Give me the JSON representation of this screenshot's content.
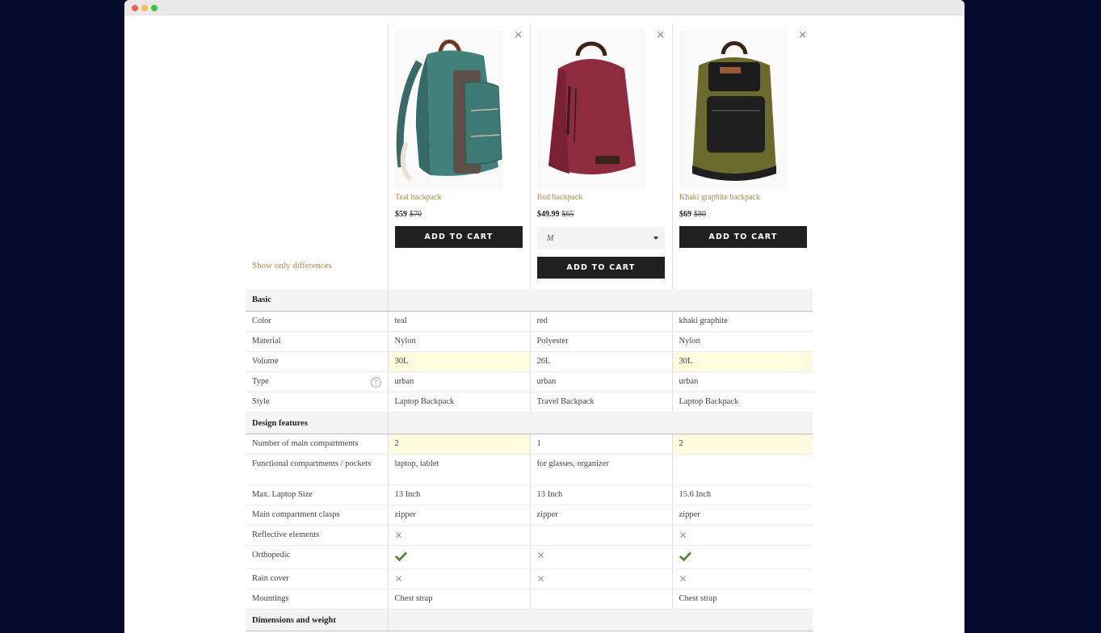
{
  "show_differences_label": "Show only differences",
  "close_symbol": "×",
  "products": [
    {
      "name": "Teal backpack",
      "price": "$59",
      "old_price": "$70",
      "button": "ADD TO CART",
      "color": "#3f7572"
    },
    {
      "name": "Red backpack",
      "price": "$49.99",
      "old_price": "$65",
      "select_value": "M",
      "button": "ADD TO CART",
      "color": "#8e2b3f"
    },
    {
      "name": "Khaki graphite backpack",
      "price": "$69",
      "old_price": "$80",
      "button": "ADD TO CART",
      "color": "#6a6a2c"
    }
  ],
  "sections": {
    "basic": "Basic",
    "design": "Design features",
    "dimensions": "Dimensions and weight"
  },
  "help_symbol": "?",
  "rows": {
    "color": {
      "label": "Color",
      "values": [
        "teal",
        "red",
        "khaki graphite"
      ]
    },
    "material": {
      "label": "Material",
      "values": [
        "Nylon",
        "Polyester",
        "Nylon"
      ]
    },
    "volume": {
      "label": "Volume",
      "values": [
        "30L",
        "26L",
        "30L"
      ]
    },
    "type": {
      "label": "Type",
      "values": [
        "urban",
        "urban",
        "urban"
      ]
    },
    "style": {
      "label": "Style",
      "values": [
        "Laptop Backpack",
        "Travel Backpack",
        "Laptop Backpack"
      ]
    },
    "main_compartments": {
      "label": "Number of main compartments",
      "values": [
        "2",
        "1",
        "2"
      ]
    },
    "functional": {
      "label": "Functional compartments / pockets",
      "values": [
        "laptop, tablet",
        "for glasses, organizer",
        ""
      ]
    },
    "laptop_size": {
      "label": "Max. Laptop Size",
      "values": [
        "13 Inch",
        "13 Inch",
        "15.6 Inch"
      ]
    },
    "clasps": {
      "label": "Main compartment clasps",
      "values": [
        "zipper",
        "zipper",
        "zipper"
      ]
    },
    "reflective": {
      "label": "Reflective elements"
    },
    "orthopedic": {
      "label": "Orthopedic"
    },
    "rain_cover": {
      "label": "Rain cover"
    },
    "mountings": {
      "label": "Mountings",
      "values": [
        "Chest strap",
        "",
        "Chest strap"
      ]
    }
  },
  "icons": {
    "no": "cross-icon",
    "yes": "checkmark-icon"
  }
}
